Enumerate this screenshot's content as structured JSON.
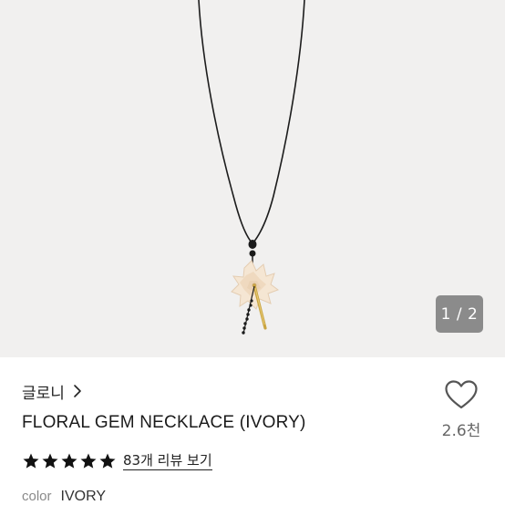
{
  "gallery": {
    "pager": "1 / 2"
  },
  "product": {
    "brand": "글로니",
    "name": "FLORAL GEM NECKLACE (IVORY)",
    "rating_stars": 5,
    "reviews_link": "83개 리뷰 보기",
    "color_label": "color",
    "color_value": "IVORY"
  },
  "like": {
    "count": "2.6천"
  },
  "icons": {
    "brand_chevron": "chevron-right-icon",
    "like": "heart-outline-icon",
    "star": "star-filled-icon"
  },
  "colors": {
    "hero_background": "#f1f0ef",
    "pager_background": "#8b8b8b",
    "star": "#111111",
    "muted_text": "#8a8a8a"
  }
}
